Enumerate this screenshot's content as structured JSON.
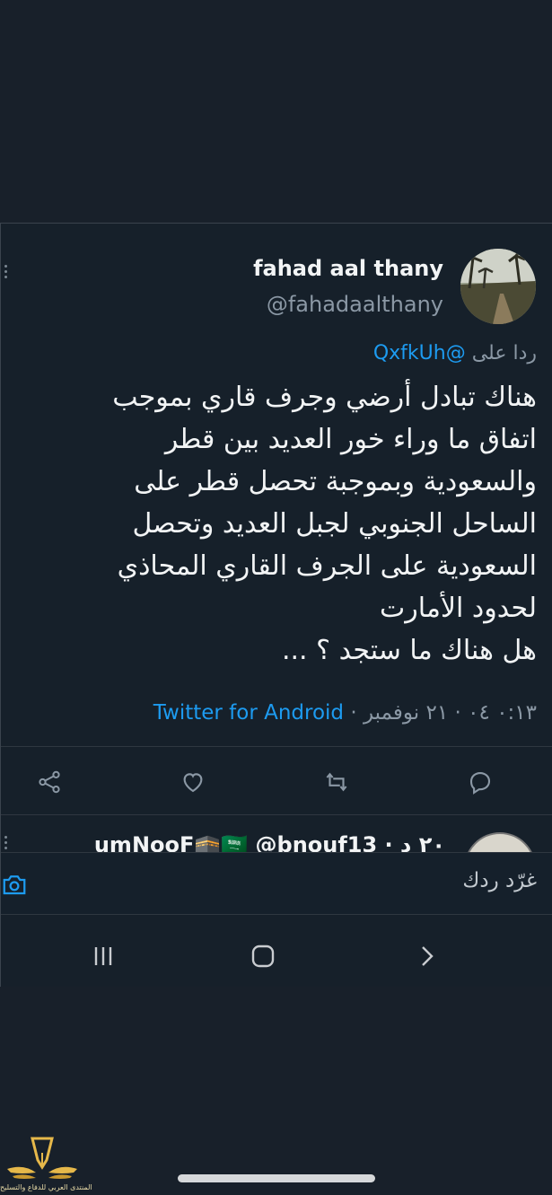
{
  "tweet": {
    "display_name": "fahad aal thany",
    "handle": "@fahadaalthany",
    "reply_prefix": "ردا على",
    "reply_to": "@QxfkUh",
    "body_lines": [
      "هناك تبادل أرضي وجرف قاري بموجب",
      "اتفاق ما وراء خور العديد بين قطر",
      "والسعودية وبموجبة تحصل قطر على",
      "الساحل الجنوبي لجبل العديد وتحصل",
      "السعودية على الجرف القاري المحاذي",
      "لحدود الأمارت",
      "هل هناك ما ستجد ؟ ..."
    ],
    "time": "٠:١٣ ٠٤",
    "date": "٢١ نوفمبر",
    "source": "Twitter for Android"
  },
  "actions": {
    "reply_icon": "reply-icon",
    "retweet_icon": "retweet-icon",
    "like_icon": "like-icon",
    "share_icon": "share-icon"
  },
  "next_reply": {
    "preview": "umNooF🕋🇸🇦 @bnouf13 · ٢٠ د"
  },
  "composer": {
    "placeholder": "غرّد ردك"
  },
  "watermark": {
    "text": "المنتدى العربي للدفاع والتسليح"
  },
  "colors": {
    "background": "#18202a",
    "accent": "#1d9bf0",
    "muted": "#8b98a5"
  }
}
